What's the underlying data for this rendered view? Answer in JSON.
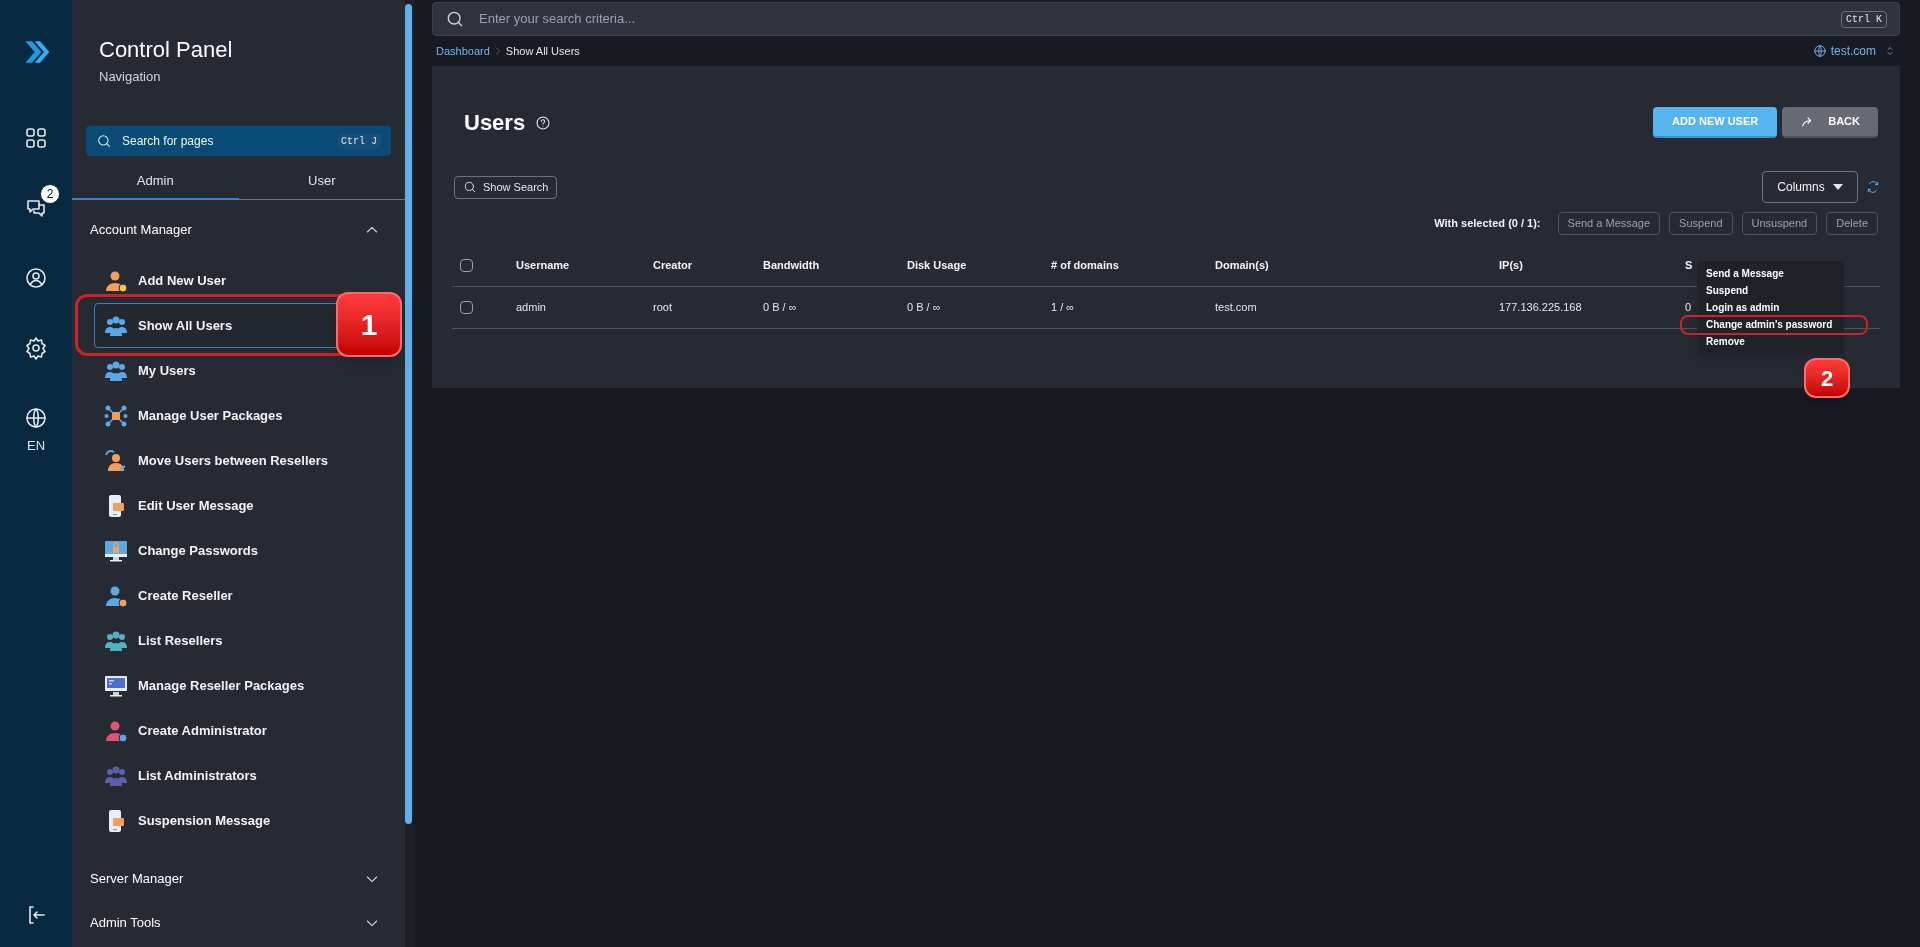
{
  "rail": {
    "notification_count": "2",
    "language": "EN"
  },
  "sidebar": {
    "title": "Control Panel",
    "subtitle": "Navigation",
    "search": {
      "placeholder": "Search for pages",
      "shortcut": "Ctrl J"
    },
    "tabs": [
      {
        "label": "Admin",
        "selected": true
      },
      {
        "label": "User",
        "selected": false
      }
    ],
    "sections": [
      {
        "title": "Account Manager",
        "expanded": true,
        "items": [
          {
            "label": "Add New User",
            "selected": false
          },
          {
            "label": "Show All Users",
            "selected": true
          },
          {
            "label": "My Users",
            "selected": false
          },
          {
            "label": "Manage User Packages",
            "selected": false
          },
          {
            "label": "Move Users between Resellers",
            "selected": false
          },
          {
            "label": "Edit User Message",
            "selected": false
          },
          {
            "label": "Change Passwords",
            "selected": false
          },
          {
            "label": "Create Reseller",
            "selected": false
          },
          {
            "label": "List Resellers",
            "selected": false
          },
          {
            "label": "Manage Reseller Packages",
            "selected": false
          },
          {
            "label": "Create Administrator",
            "selected": false
          },
          {
            "label": "List Administrators",
            "selected": false
          },
          {
            "label": "Suspension Message",
            "selected": false
          }
        ]
      },
      {
        "title": "Server Manager",
        "expanded": false
      },
      {
        "title": "Admin Tools",
        "expanded": false
      }
    ]
  },
  "topbar": {
    "search": {
      "placeholder": "Enter your search criteria...",
      "shortcut": "Ctrl K"
    }
  },
  "breadcrumb": [
    "Dashboard",
    "Show All Users"
  ],
  "domain_selector": "test.com",
  "page": {
    "title": "Users",
    "buttons": [
      {
        "label": "ADD NEW USER",
        "kind": "primary"
      },
      {
        "label": "BACK",
        "kind": "secondary"
      }
    ],
    "show_search": "Show Search",
    "columns_button": "Columns",
    "with_selected": "With selected (0 / 1):",
    "bulk_actions": [
      "Send a Message",
      "Suspend",
      "Unsuspend",
      "Delete"
    ],
    "table": {
      "select_all_checked": false,
      "columns": [
        "Username",
        "Creator",
        "Bandwidth",
        "Disk Usage",
        "# of domains",
        "Domain(s)",
        "IP(s)",
        "S"
      ],
      "rows": [
        {
          "checked": false,
          "cells": [
            "admin",
            "root",
            "0 B / ∞",
            "0 B / ∞",
            "1 / ∞",
            "test.com",
            "177.136.225.168",
            "0"
          ]
        }
      ]
    },
    "context_menu": [
      "Send a Message",
      "Suspend",
      "Login as admin",
      "Change admin's password",
      "Remove"
    ]
  },
  "annotations": [
    {
      "label": "1"
    },
    {
      "label": "2"
    }
  ]
}
